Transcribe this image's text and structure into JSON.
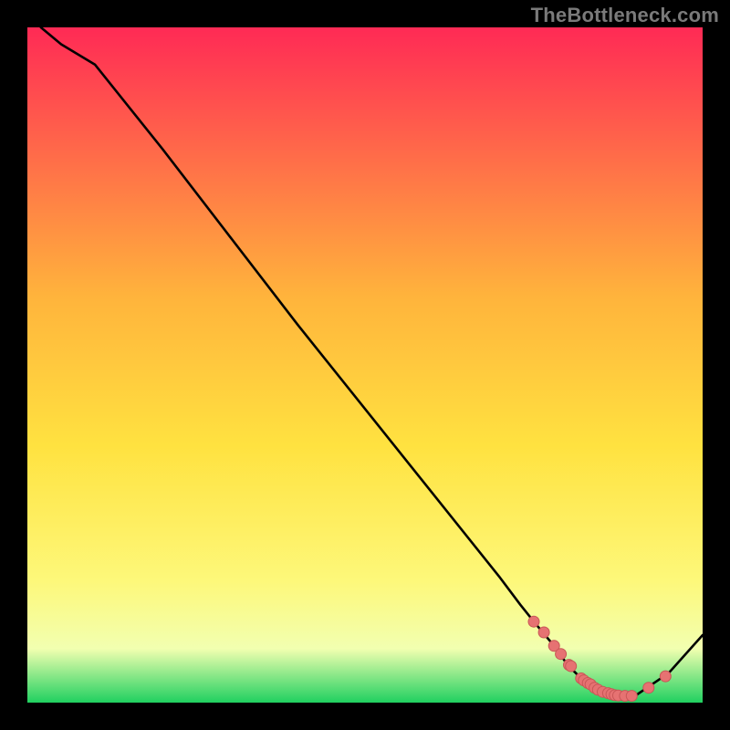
{
  "watermark": "TheBottleneck.com",
  "colors": {
    "black": "#000000",
    "curve": "#000000",
    "dot_fill": "#e67272",
    "dot_stroke": "#c85757",
    "grad_top": "#ff2a55",
    "grad_mid1": "#ffb43c",
    "grad_mid2": "#ffe240",
    "grad_mid3": "#fdf87a",
    "grad_mid4": "#f2ffb0",
    "grad_bot": "#20d060"
  },
  "chart_data": {
    "type": "line",
    "title": "",
    "xlabel": "",
    "ylabel": "",
    "xlim": [
      0,
      100
    ],
    "ylim": [
      0,
      100
    ],
    "grid": false,
    "legend": false,
    "x": [
      2,
      5,
      10,
      20,
      30,
      40,
      50,
      60,
      70,
      73,
      75,
      78,
      80,
      82,
      84,
      86,
      88,
      90,
      95,
      100
    ],
    "values": [
      100,
      97.5,
      94.5,
      82,
      69,
      56,
      43.5,
      31,
      18.5,
      14.5,
      12,
      8.4,
      5.6,
      3.6,
      2.2,
      1.4,
      1.0,
      1.0,
      4.4,
      10.0
    ],
    "markers_x": [
      75,
      76.5,
      78,
      79,
      80.2,
      80.5,
      82,
      82.4,
      83,
      83.4,
      84,
      84.5,
      85.2,
      86,
      86.5,
      87,
      87.5,
      88.5,
      89.5,
      92,
      94.5
    ],
    "markers_val": [
      12,
      10.4,
      8.4,
      7.2,
      5.6,
      5.4,
      3.6,
      3.3,
      2.9,
      2.7,
      2.2,
      1.9,
      1.6,
      1.4,
      1.25,
      1.1,
      1.05,
      1.0,
      1.0,
      2.2,
      3.9
    ]
  }
}
